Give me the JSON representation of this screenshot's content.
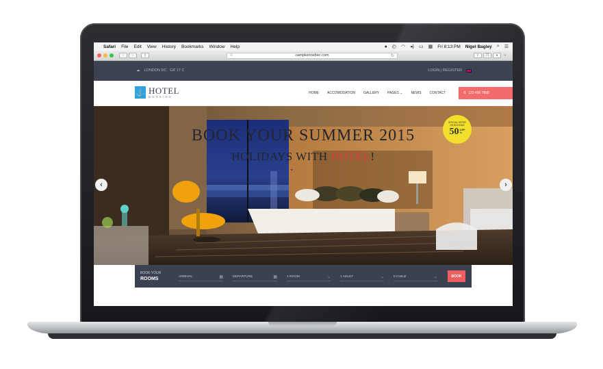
{
  "menubar": {
    "app": "Safari",
    "items": [
      "File",
      "Edit",
      "View",
      "History",
      "Bookmarks",
      "Window",
      "Help"
    ],
    "datetime": "Fri 8:13 PM",
    "user": "Nigel Bagley"
  },
  "browser": {
    "url": "campkennebec.com"
  },
  "site": {
    "topbar": {
      "location": "LONDON DC , GR 17 C",
      "login": "LOGIN | REGISTER"
    },
    "logo": {
      "main": "HOTEL",
      "sub": "BOOKING"
    },
    "nav": [
      "HOME",
      "ACCOMODATION",
      "GALLERY",
      "PAGES",
      "NEWS",
      "CONTACT"
    ],
    "phone": "123 456 7890",
    "hero": {
      "title": "BOOK YOUR SUMMER 2015",
      "subtitle_prefix": "HOLIDAYS WITH ",
      "subtitle_highlight": "HOTEL",
      "subtitle_suffix": "!",
      "badge": {
        "line1": "SPECIAL OFFER",
        "line2": "ON BOOKING",
        "value": "50",
        "off": "OFF",
        "pct": "%"
      },
      "prev_arrow": "‹",
      "next_arrow": "›"
    },
    "booking": {
      "label_line1": "BOOK YOUR",
      "label_line2": "ROOMS",
      "arrival": "ARRIVAL",
      "departure": "DEPARTURE",
      "rooms": "1 ROOM",
      "adults": "1 ADULT",
      "children": "0 CHILD",
      "button": "BOOK"
    }
  },
  "colors": {
    "topbar": "#3c4250",
    "accent": "#f36b6b",
    "logo": "#2fa3df",
    "badge": "#f2df2c"
  }
}
